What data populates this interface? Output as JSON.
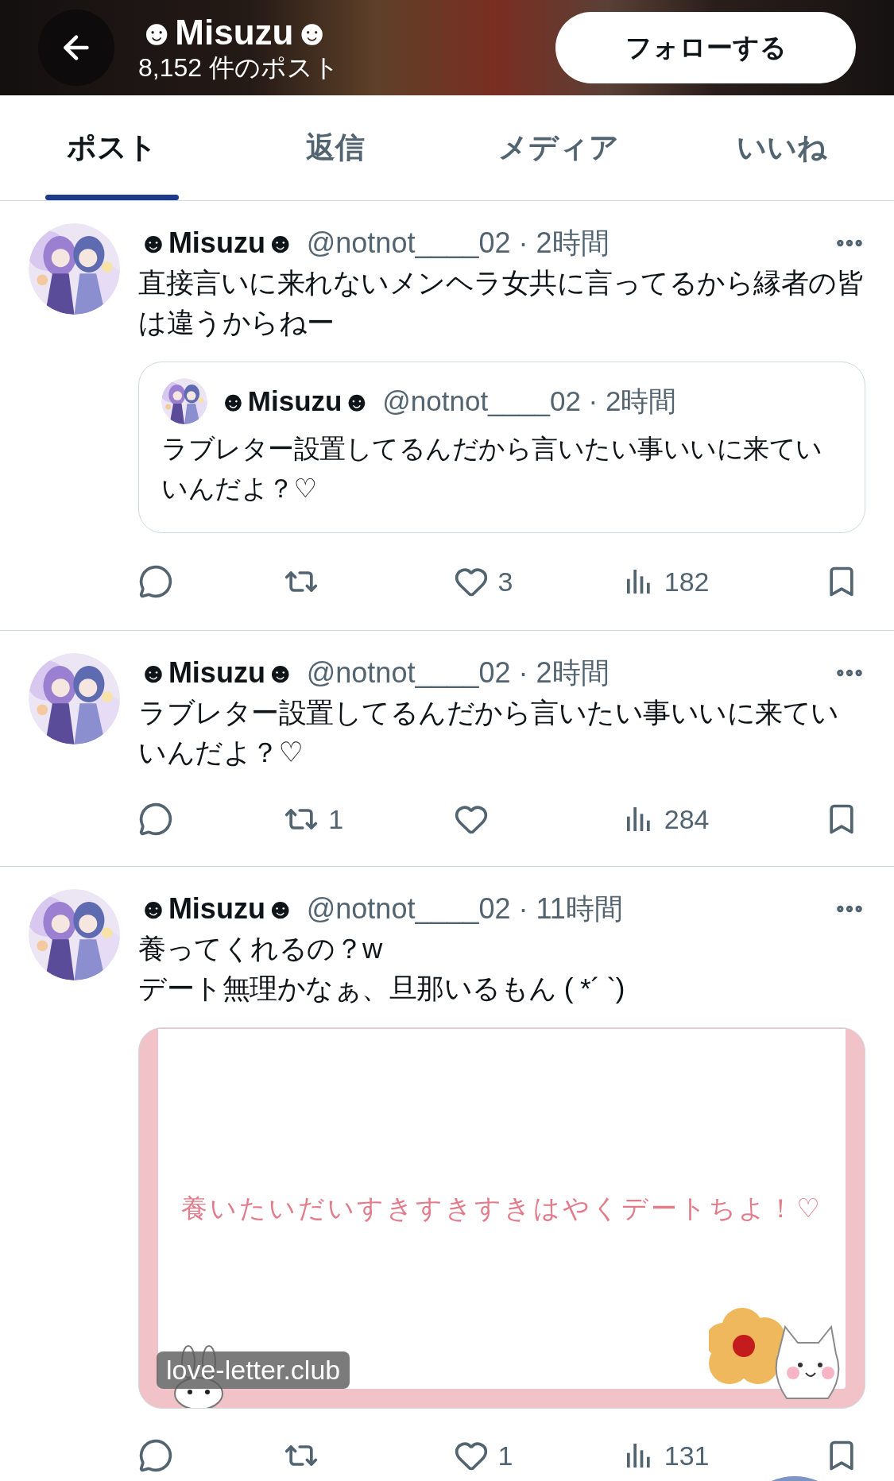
{
  "header": {
    "title": "☻Misuzu☻",
    "subtitle": "8,152 件のポスト",
    "follow_button": "フォローする"
  },
  "tabs": [
    {
      "label": "ポスト",
      "selected": true
    },
    {
      "label": "返信",
      "selected": false
    },
    {
      "label": "メディア",
      "selected": false
    },
    {
      "label": "いいね",
      "selected": false
    }
  ],
  "posts": [
    {
      "name": "☻Misuzu☻",
      "meta": "@notnot____02 · 2時間",
      "text": "直接言いに来れないメンヘラ女共に言ってるから縁者の皆は違うからねー",
      "quote": {
        "name": "☻Misuzu☻",
        "meta": "@notnot____02 · 2時間",
        "text": "ラブレター設置してるんだから言いたい事いいに来ていいんだよ？♡"
      },
      "actions": [
        {
          "kind": "reply"
        },
        {
          "kind": "repost"
        },
        {
          "kind": "like",
          "count": "3"
        },
        {
          "kind": "views",
          "count": "182"
        },
        {
          "kind": "bookmark"
        }
      ]
    },
    {
      "name": "☻Misuzu☻",
      "meta": "@notnot____02 · 2時間",
      "text": "ラブレター設置してるんだから言いたい事いいに来ていいんだよ？♡",
      "actions": [
        {
          "kind": "reply"
        },
        {
          "kind": "repost",
          "count": "1"
        },
        {
          "kind": "like"
        },
        {
          "kind": "views",
          "count": "284"
        },
        {
          "kind": "bookmark"
        }
      ]
    },
    {
      "name": "☻Misuzu☻",
      "meta": "@notnot____02 · 11時間",
      "text": "養ってくれるの？w\nデート無理かなぁ、旦那いるもん ( *´ `)",
      "card": {
        "message": "養いたいだいすきすきすきはやくデートちよ！♡",
        "domain": "love-letter.club"
      },
      "actions": [
        {
          "kind": "reply"
        },
        {
          "kind": "repost"
        },
        {
          "kind": "like",
          "count": "1"
        },
        {
          "kind": "views",
          "count": "131"
        },
        {
          "kind": "bookmark"
        }
      ]
    }
  ]
}
